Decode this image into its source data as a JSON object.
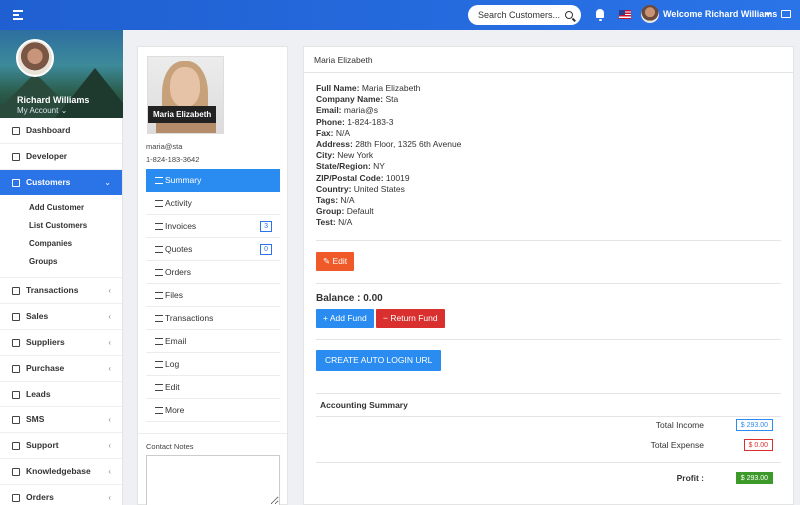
{
  "topbar": {
    "search_placeholder": "Search Customers...",
    "welcome": "Welcome Richard Williams",
    "icons": [
      "menu-icon",
      "search-icon",
      "bell-icon",
      "flag-us-icon",
      "avatar",
      "chevron-down-icon",
      "message-icon"
    ]
  },
  "sidebar": {
    "user_name": "Richard Williams",
    "account_label": "My Account",
    "items": [
      {
        "label": "Dashboard",
        "icon": "dashboard-icon"
      },
      {
        "label": "Developer",
        "icon": "file-icon"
      },
      {
        "label": "Customers",
        "icon": "users-icon",
        "active": true
      },
      {
        "label": "Transactions",
        "icon": "transactions-icon"
      },
      {
        "label": "Sales",
        "icon": "sales-icon"
      },
      {
        "label": "Suppliers",
        "icon": "suppliers-icon"
      },
      {
        "label": "Purchase",
        "icon": "purchase-icon"
      },
      {
        "label": "Leads",
        "icon": "leads-icon"
      },
      {
        "label": "SMS",
        "icon": "sms-icon"
      },
      {
        "label": "Support",
        "icon": "support-icon"
      },
      {
        "label": "Knowledgebase",
        "icon": "knowledgebase-icon"
      },
      {
        "label": "Orders",
        "icon": "orders-icon"
      }
    ],
    "customers_sub": [
      "Add Customer",
      "List Customers",
      "Companies",
      "Groups"
    ]
  },
  "profile": {
    "name_tag": "Maria Elizabeth",
    "email": "maria@sta",
    "phone": "1-824-183-3642",
    "menu": [
      {
        "label": "Summary",
        "active": true
      },
      {
        "label": "Activity"
      },
      {
        "label": "Invoices",
        "count": "3"
      },
      {
        "label": "Quotes",
        "count": "0"
      },
      {
        "label": "Orders"
      },
      {
        "label": "Files"
      },
      {
        "label": "Transactions"
      },
      {
        "label": "Email"
      },
      {
        "label": "Log"
      },
      {
        "label": "Edit"
      },
      {
        "label": "More"
      }
    ],
    "notes_label": "Contact Notes"
  },
  "details": {
    "header": "Maria Elizabeth",
    "fields": [
      {
        "label": "Full Name:",
        "value": "Maria Elizabeth"
      },
      {
        "label": "Company Name:",
        "value": "Sta"
      },
      {
        "label": "Email:",
        "value": "maria@s"
      },
      {
        "label": "Phone:",
        "value": "1-824-183-3"
      },
      {
        "label": "Fax:",
        "value": "N/A"
      },
      {
        "label": "Address:",
        "value": "28th Floor, 1325 6th Avenue"
      },
      {
        "label": "City:",
        "value": "New York"
      },
      {
        "label": "State/Region:",
        "value": "NY"
      },
      {
        "label": "ZIP/Postal Code:",
        "value": "10019"
      },
      {
        "label": "Country:",
        "value": "United States"
      },
      {
        "label": "Tags:",
        "value": "N/A"
      },
      {
        "label": "Group:",
        "value": "Default"
      },
      {
        "label": "Test:",
        "value": "N/A"
      }
    ],
    "edit_button": "Edit",
    "balance": "Balance : 0.00",
    "add_fund": "Add Fund",
    "return_fund": "Return Fund",
    "auto_login": "CREATE AUTO LOGIN URL"
  },
  "accounting": {
    "title": "Accounting Summary",
    "total_income_label": "Total Income",
    "total_income": "$ 293.00",
    "total_expense_label": "Total Expense",
    "total_expense": "$ 0.00",
    "profit_label": "Profit :",
    "profit": "$ 293.00"
  },
  "colors": {
    "primary": "#2a74e8",
    "edit": "#f05a28",
    "danger": "#d9302f",
    "success": "#3d9a2a"
  }
}
